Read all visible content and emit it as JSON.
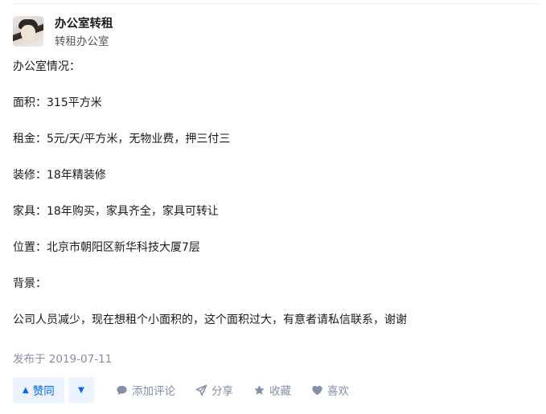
{
  "author": {
    "name": "办公室转租",
    "headline": "转租办公室"
  },
  "content": {
    "lines": [
      "办公室情况：",
      "面积：315平方米",
      "租金：5元/天/平方米，无物业费，押三付三",
      "装修：18年精装修",
      "家具：18年购买，家具齐全，家具可转让",
      "位置：北京市朝阳区新华科技大厦7层",
      "背景：",
      "公司人员减少，现在想租个小面积的，这个面积过大，有意者请私信联系，谢谢"
    ]
  },
  "published": "发布于 2019-07-11",
  "actions": {
    "vote_up": "赞同",
    "comment": "添加评论",
    "share": "分享",
    "favorite": "收藏",
    "like": "喜欢"
  },
  "colors": {
    "accent": "#0066ff",
    "accent_bg": "#ebf3ff",
    "muted": "#8590a6"
  },
  "icons": [
    "vote-up-triangle-icon",
    "vote-down-triangle-icon",
    "comment-icon",
    "share-icon",
    "star-icon",
    "heart-icon"
  ]
}
